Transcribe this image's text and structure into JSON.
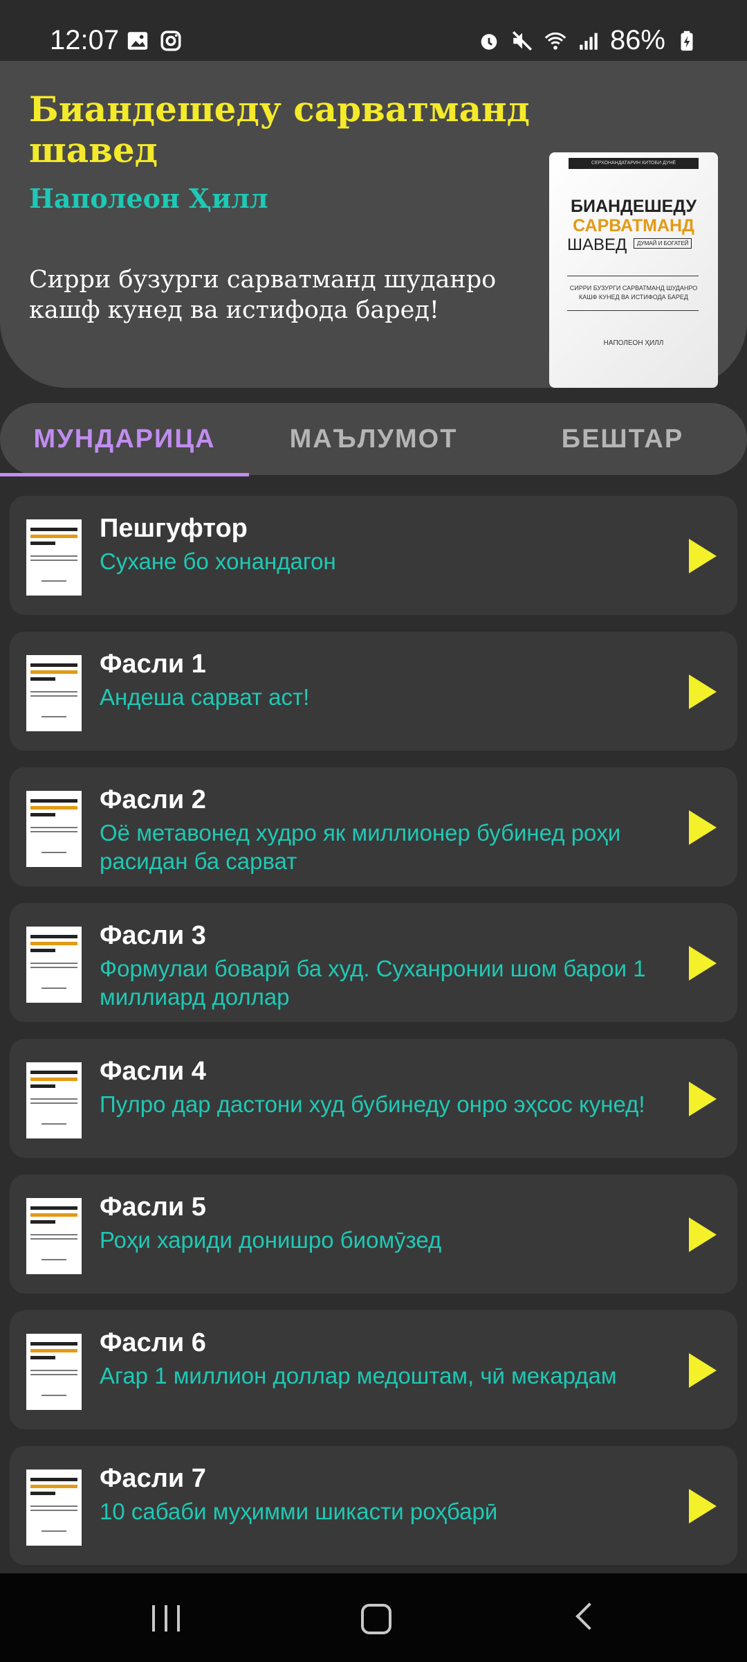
{
  "status_bar": {
    "time": "12:07",
    "battery": "86%",
    "icons": [
      "gallery-icon",
      "instagram-icon",
      "alarm-icon",
      "mute-icon",
      "wifi-icon",
      "signal-icon",
      "battery-charging-icon"
    ]
  },
  "header": {
    "title": "Биандешеду сарватманд шавед",
    "author": "Наполеон Ҳилл",
    "subtitle": "Сирри бузурги сарватманд шуданро кашф кунед ва истифода баред!",
    "cover": {
      "series": "СЕРХОНАНДАТАРИН КИТОБИ ДУНЁ",
      "line1": "БИАНДЕШЕДУ",
      "line2": "САРВАТМАНД",
      "line3": "ШАВЕД",
      "tag": "ДУМАЙ И БОГАТЕЙ",
      "tagline": "СИРРИ БУЗУРГИ САРВАТМАНД ШУДАНРО КАШФ КУНЕД ВА ИСТИФОДА БАРЕД",
      "author": "НАПОЛЕОН ҲИЛЛ"
    }
  },
  "tabs": [
    {
      "label": "МУНДАРИЦА",
      "active": true
    },
    {
      "label": "МАЪЛУМОТ",
      "active": false
    },
    {
      "label": "БЕШТАР",
      "active": false
    }
  ],
  "chapters": [
    {
      "title": "Пешгуфтор",
      "desc": "Сухане бо хонандагон"
    },
    {
      "title": "Фасли 1",
      "desc": "Андеша сарват аст!"
    },
    {
      "title": "Фасли 2",
      "desc": "Оё метавонед худро як миллионер бубинед роҳи расидан ба сарват"
    },
    {
      "title": "Фасли 3",
      "desc": "Формулаи боварӣ ба худ. Суханронии шом барои 1 миллиард доллар"
    },
    {
      "title": "Фасли 4",
      "desc": "Пулро дар дастони худ бубинеду онро эҳсос кунед!"
    },
    {
      "title": "Фасли 5",
      "desc": "Роҳи хариди донишро биомӯзед"
    },
    {
      "title": "Фасли 6",
      "desc": "Агар 1 миллион доллар медоштам, чӣ мекардам"
    },
    {
      "title": "Фасли 7",
      "desc": "10 сабаби муҳимми шикасти роҳбарӣ"
    }
  ],
  "colors": {
    "accent": "#c08df0",
    "title_yellow": "#f4ea2a",
    "teal": "#1ec9b5",
    "play_yellow": "#f4f02a"
  }
}
